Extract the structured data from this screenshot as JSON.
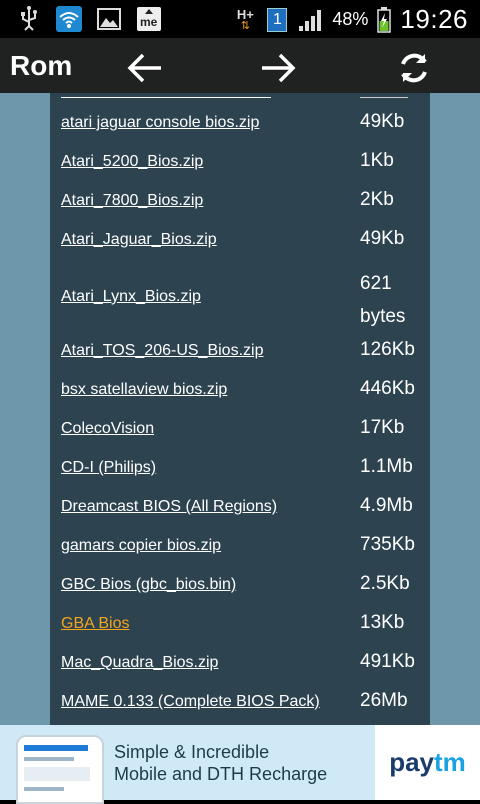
{
  "status_bar": {
    "network_label": "H+",
    "notification_count": "1",
    "battery_percent": "48%",
    "time": "19:26",
    "icons": [
      "usb-icon",
      "wifi-icon",
      "image-icon",
      "me-app-icon",
      "network-icon",
      "signal-icon",
      "battery-icon"
    ]
  },
  "toolbar": {
    "title": "Rom",
    "buttons": [
      "back-arrow-icon",
      "forward-arrow-icon",
      "refresh-icon"
    ]
  },
  "files": [
    {
      "name": "atari jaguar console bios.zip",
      "size": "49Kb"
    },
    {
      "name": "Atari_5200_Bios.zip",
      "size": "1Kb"
    },
    {
      "name": "Atari_7800_Bios.zip",
      "size": "2Kb"
    },
    {
      "name": "Atari_Jaguar_Bios.zip",
      "size": "49Kb"
    },
    {
      "name": "Atari_Lynx_Bios.zip",
      "size": "621 bytes"
    },
    {
      "name": "Atari_TOS_206-US_Bios.zip",
      "size": "126Kb"
    },
    {
      "name": "bsx satellaview bios.zip",
      "size": "446Kb"
    },
    {
      "name": "ColecoVision",
      "size": "17Kb"
    },
    {
      "name": "CD-I (Philips)",
      "size": "1.1Mb"
    },
    {
      "name": "Dreamcast BIOS (All Regions)",
      "size": "4.9Mb"
    },
    {
      "name": "gamars copier bios.zip",
      "size": "735Kb"
    },
    {
      "name": "GBC Bios (gbc_bios.bin)",
      "size": "2.5Kb"
    },
    {
      "name": "GBA Bios",
      "size": "13Kb"
    },
    {
      "name": "Mac_Quadra_Bios.zip",
      "size": "491Kb"
    },
    {
      "name": "MAME 0.133 (Complete BIOS Pack)",
      "size": "26Mb"
    }
  ],
  "active_file": "GBA Bios",
  "ad": {
    "line1": "Simple & Incredible",
    "line2": "Mobile and DTH Recharge",
    "brand_part1": "pay",
    "brand_part2": "tm"
  },
  "colors": {
    "content_bg": "#6f97ab",
    "panel_bg": "#2d4350",
    "active_link": "#f4a51c"
  }
}
